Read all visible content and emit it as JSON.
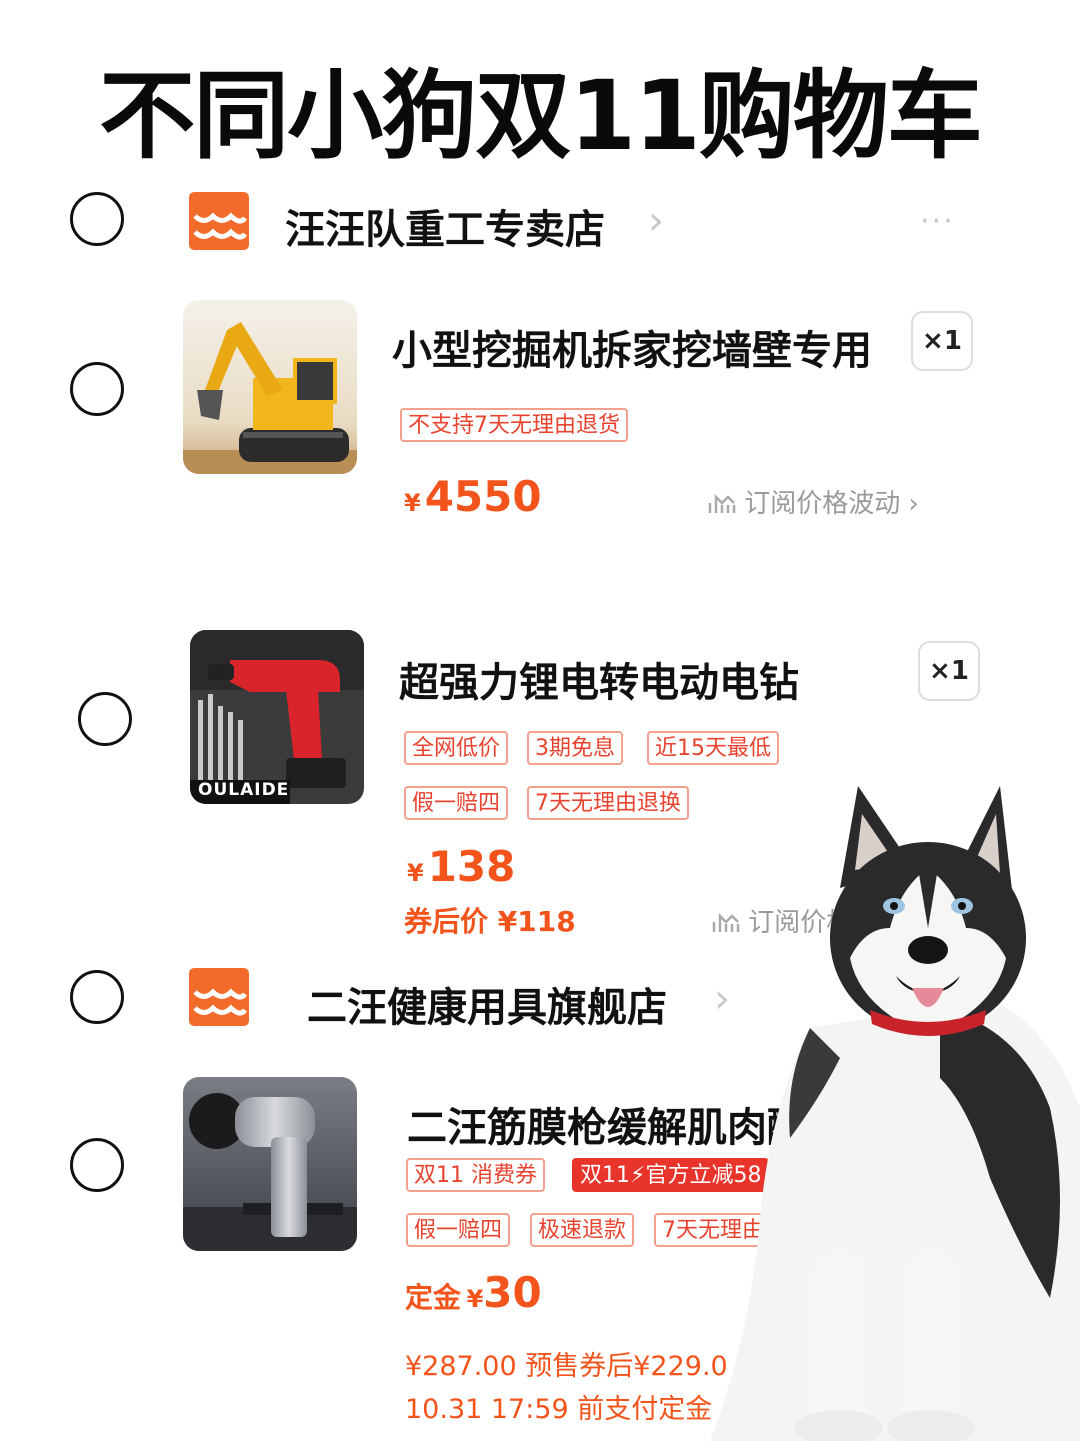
{
  "page_title": "不同小狗双11购物车",
  "stores": [
    {
      "name": "汪汪队重工专卖店",
      "more": "···",
      "items": [
        {
          "name": "小型挖掘机拆家挖墙壁专用",
          "qty": "×1",
          "tags_row1": [
            "不支持7天无理由退货"
          ],
          "currency": "¥",
          "price": "4550",
          "subscribe": "订阅价格波动"
        }
      ]
    },
    {
      "items": [
        {
          "name": "超强力锂电转电动电钻",
          "qty": "×1",
          "tags_row1": [
            "全网低价",
            "3期免息",
            "近15天最低"
          ],
          "tags_row2": [
            "假一赔四",
            "7天无理由退换"
          ],
          "currency": "¥",
          "price": "138",
          "coupon_price": "券后价 ¥118",
          "subscribe": "订阅价格",
          "brand_mark": "OULAIDE"
        }
      ]
    },
    {
      "name": "二汪健康用具旗舰店",
      "items": [
        {
          "name": "二汪筋膜枪缓解肌肉酸",
          "tags_row1": [
            "双11 消费券",
            "双11⚡官方立减58"
          ],
          "tags_row2": [
            "假一赔四",
            "极速退款",
            "7天无理由"
          ],
          "deposit_label": "定金",
          "currency": "¥",
          "deposit": "30",
          "presale_line": "¥287.00  预售券后¥229.0",
          "deadline_line": "10.31 17:59 前支付定金"
        }
      ]
    }
  ],
  "icons": {
    "store": "store-icon",
    "chevron": "chevron-right-icon",
    "trend": "trend-chart-icon"
  },
  "colors": {
    "accent": "#f2541b",
    "store_icon": "#f26b2a",
    "tag_border": "#f3a08e",
    "tag_text": "#e8432f",
    "tag_fill": "#e8342a"
  }
}
